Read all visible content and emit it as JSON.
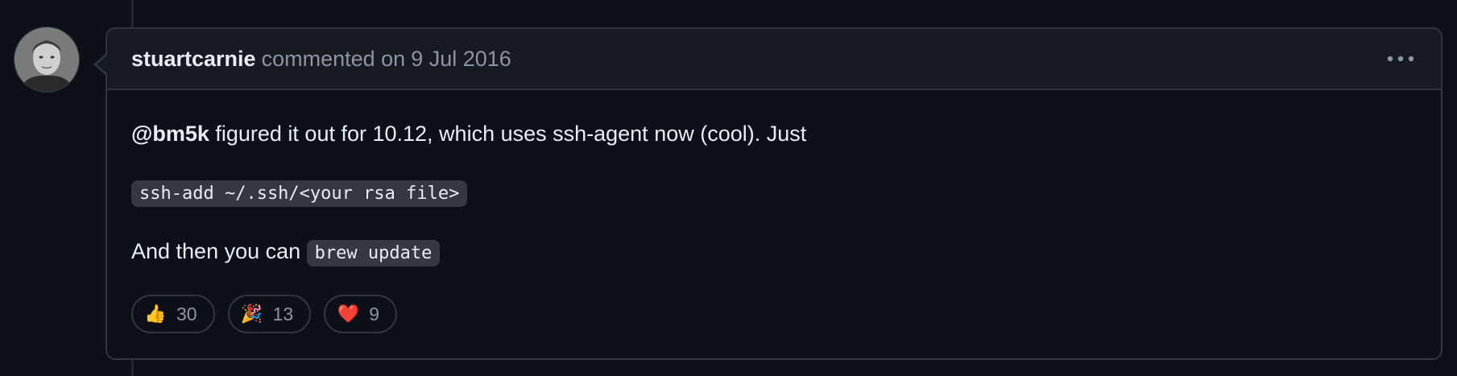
{
  "comment": {
    "author": "stuartcarnie",
    "action": "commented on",
    "date": "9 Jul 2016",
    "body": {
      "mention": "@bm5k",
      "line1_rest": " figured it out for 10.12, which uses ssh-agent now (cool). Just",
      "code1": "ssh-add ~/.ssh/<your rsa file>",
      "line3_prefix": "And then you can ",
      "code2": "brew update"
    },
    "reactions": [
      {
        "emoji": "👍",
        "icon": "thumbs-up-icon",
        "count": "30"
      },
      {
        "emoji": "🎉",
        "icon": "tada-icon",
        "count": "13"
      },
      {
        "emoji": "❤️",
        "icon": "heart-icon",
        "count": "9"
      }
    ]
  },
  "colors": {
    "background": "#0d1117",
    "header_bg": "#161b22",
    "border": "#30363d",
    "muted_text": "#8d96a0",
    "text": "#e6edf3",
    "code_bg": "#343941"
  }
}
